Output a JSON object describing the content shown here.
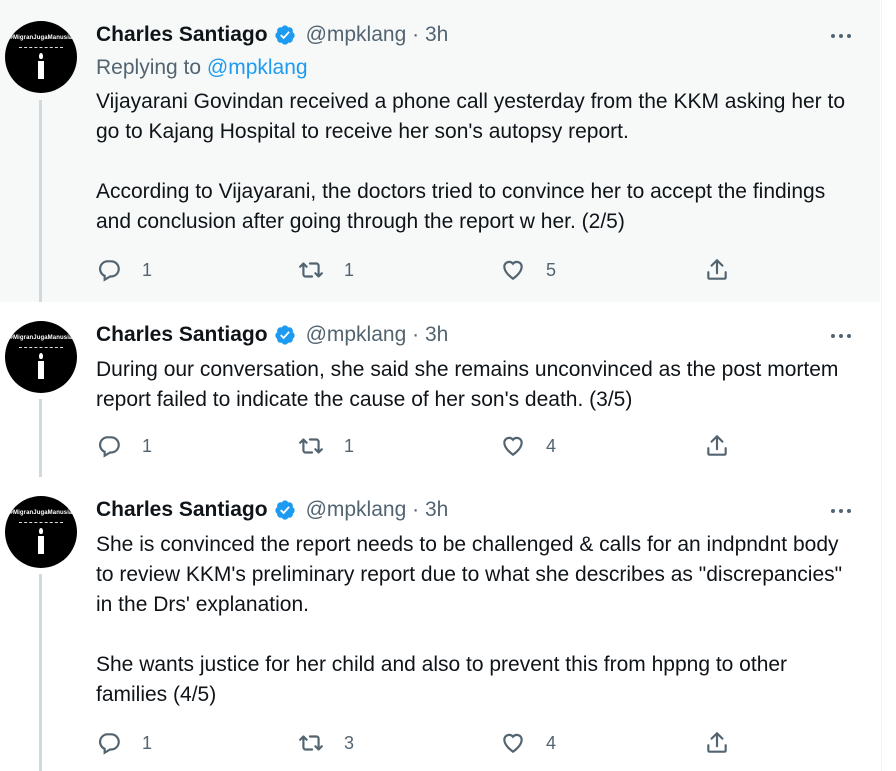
{
  "tweets": [
    {
      "author_name": "Charles Santiago",
      "handle": "@mpklang",
      "separator": "·",
      "time": "3h",
      "replying_prefix": "Replying to",
      "replying_to": "@mpklang",
      "paragraphs": [
        "Vijayarani Govindan received a phone call yesterday from the KKM asking her to go to Kajang Hospital to receive her son's autopsy report.",
        "According to Vijayarani, the doctors tried to convince her to accept the findings and conclusion after going through the report w her. (2/5)"
      ],
      "replies": "1",
      "retweets": "1",
      "likes": "5"
    },
    {
      "author_name": "Charles Santiago",
      "handle": "@mpklang",
      "separator": "·",
      "time": "3h",
      "paragraphs": [
        "During our conversation, she said she remains unconvinced as the post mortem report failed to indicate the cause of her son's death. (3/5)"
      ],
      "replies": "1",
      "retweets": "1",
      "likes": "4"
    },
    {
      "author_name": "Charles Santiago",
      "handle": "@mpklang",
      "separator": "·",
      "time": "3h",
      "paragraphs": [
        "She is convinced the report needs to be challenged & calls for an indpndnt body to review KKM's preliminary report due to what she describes as \"discrepancies\" in the Drs' explanation.",
        "She wants justice for her child and also to prevent this from hppng to other families (4/5)"
      ],
      "replies": "1",
      "retweets": "3",
      "likes": "4"
    }
  ],
  "avatar": {
    "hashtag": "#MigranJugaManusia"
  },
  "icons": {
    "verified": "verified-badge-icon",
    "more": "more-icon",
    "reply": "reply-icon",
    "retweet": "retweet-icon",
    "like": "heart-icon",
    "share": "share-icon"
  },
  "colors": {
    "accent": "#1d9bf0",
    "text": "#0f1419",
    "muted": "#536471",
    "highlight_bg": "#f7f9f9",
    "thread_line": "#cfd9de"
  }
}
